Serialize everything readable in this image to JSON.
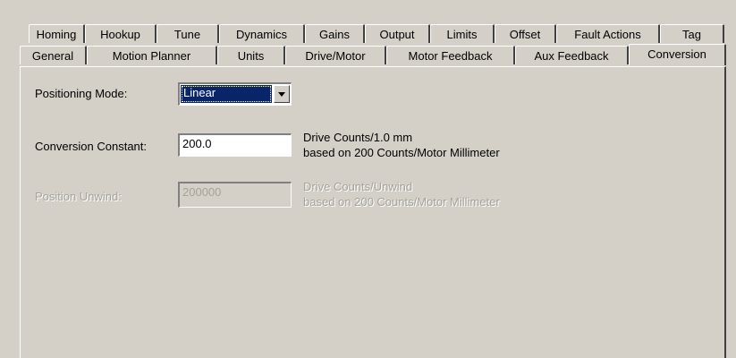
{
  "tabs_back_row": [
    "Homing",
    "Hookup",
    "Tune",
    "Dynamics",
    "Gains",
    "Output",
    "Limits",
    "Offset",
    "Fault Actions",
    "Tag"
  ],
  "tabs_front_row": [
    "General",
    "Motion Planner",
    "Units",
    "Drive/Motor",
    "Motor Feedback",
    "Aux Feedback",
    "Conversion"
  ],
  "active_tab": "Conversion",
  "positioning_mode": {
    "label": "Positioning Mode:",
    "value": "Linear"
  },
  "conversion_constant": {
    "label": "Conversion Constant:",
    "value": "200.0",
    "units": "Drive Counts/1.0 mm",
    "note": "based on 200 Counts/Motor Millimeter"
  },
  "position_unwind": {
    "label": "Position Unwind:",
    "value": "200000",
    "units": "Drive Counts/Unwind",
    "note": "based on 200 Counts/Motor Millimeter",
    "enabled": false
  },
  "colors": {
    "face": "#d4d0c8",
    "selection": "#0a246a",
    "disabled_text": "#a6a39a"
  }
}
